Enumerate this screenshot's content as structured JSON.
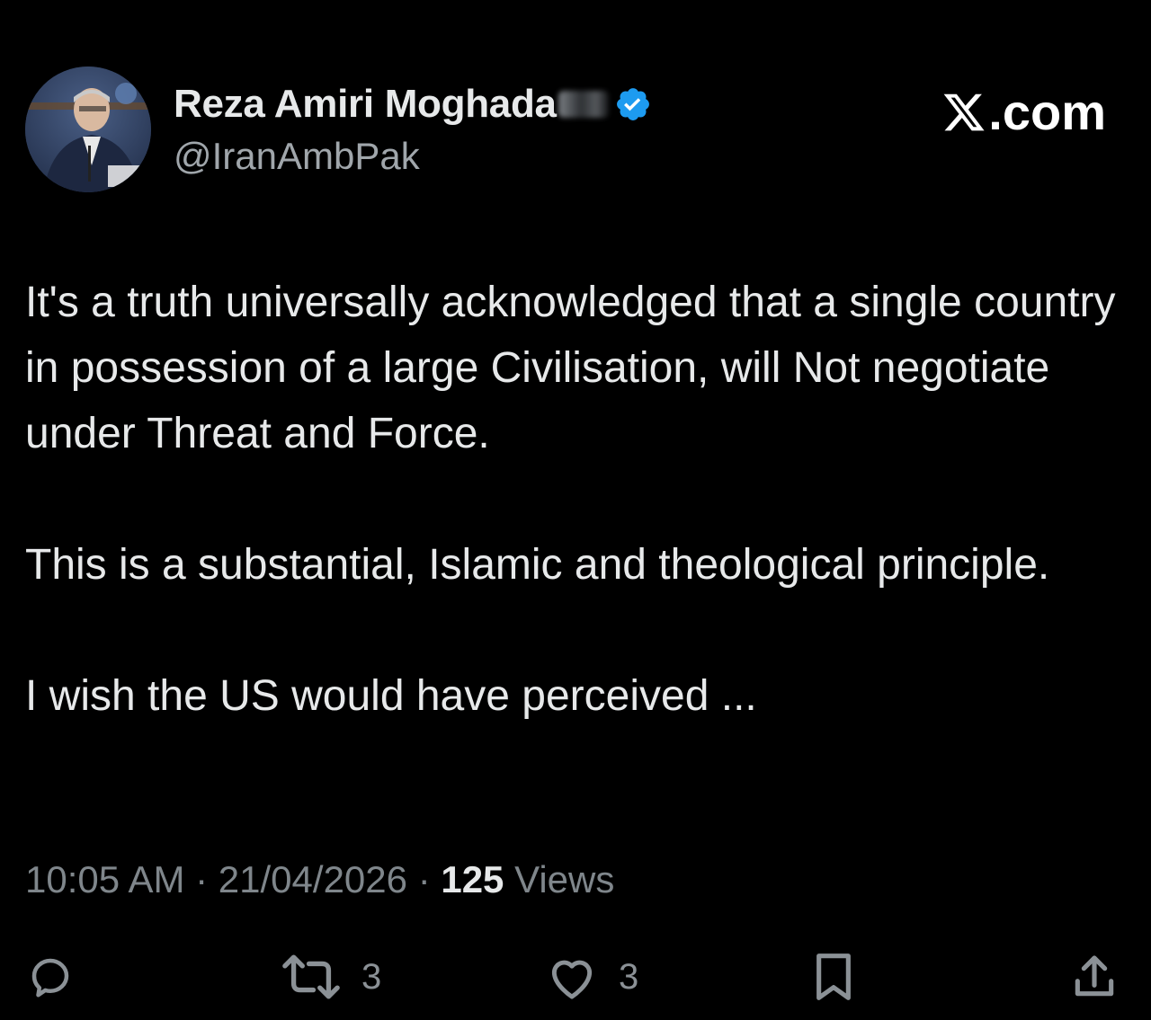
{
  "author": {
    "display_name": "Reza Amiri Moghada",
    "handle": "@IranAmbPak",
    "verified": true
  },
  "brand": {
    "text": ".com"
  },
  "tweet": {
    "paragraphs": [
      "It's a truth universally acknowledged that a single country in possession of a large Civilisation, will Not negotiate under Threat and Force.",
      "This is a substantial, Islamic and theological principle.",
      "I wish the US would have perceived ..."
    ]
  },
  "meta": {
    "time": "10:05 AM",
    "date": "21/04/2026",
    "separator": "·",
    "views_count": "125",
    "views_label": "Views"
  },
  "actions": {
    "reply_count": "",
    "retweet_count": "3",
    "like_count": "3"
  },
  "colors": {
    "background": "#000000",
    "text": "#e7e9ea",
    "secondary": "#7f868b",
    "verified": "#1d9bf0"
  },
  "icons": {
    "verified": "verified-badge-icon",
    "brand": "x-logo-icon",
    "reply": "reply-icon",
    "retweet": "retweet-icon",
    "like": "heart-icon",
    "bookmark": "bookmark-icon",
    "share": "share-icon"
  }
}
